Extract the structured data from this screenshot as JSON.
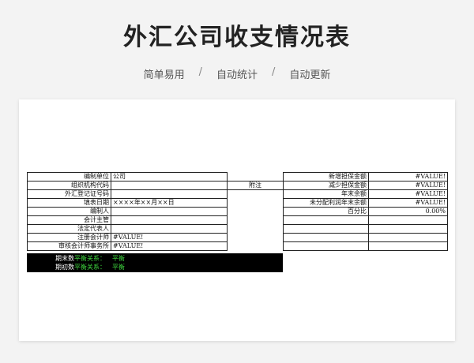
{
  "title": "外汇公司收支情况表",
  "subtitle": {
    "items": [
      "简单易用",
      "自动统计",
      "自动更新"
    ],
    "separator": "/"
  },
  "form": {
    "left_rows": [
      {
        "label": "编制单位",
        "value": "公司",
        "note": ""
      },
      {
        "label": "组织机构代码",
        "value": "",
        "note": "附注"
      },
      {
        "label": "外汇登记证号码",
        "value": "",
        "note": ""
      },
      {
        "label": "填表日期",
        "value": "××××年××月××日",
        "note": ""
      },
      {
        "label": "编制人",
        "value": "",
        "note": ""
      },
      {
        "label": "会计主管",
        "value": "",
        "note": ""
      },
      {
        "label": "法定代表人",
        "value": "",
        "note": ""
      },
      {
        "label": "注册会计师",
        "value": "#VALUE!",
        "note": ""
      },
      {
        "label": "审核会计师事务所",
        "value": "#VALUE!",
        "note": ""
      }
    ],
    "right_rows": [
      {
        "label": "新增担保金额",
        "value": "#VALUE!"
      },
      {
        "label": "减少担保金额",
        "value": "#VALUE!"
      },
      {
        "label": "年末余额",
        "value": "#VALUE!"
      },
      {
        "label": "未分配利润年末余额",
        "value": "#VALUE!"
      },
      {
        "label": "百分比",
        "value": "0.00%"
      },
      {
        "label": "",
        "value": ""
      },
      {
        "label": "",
        "value": ""
      },
      {
        "label": "",
        "value": ""
      },
      {
        "label": "",
        "value": ""
      }
    ],
    "balance": [
      {
        "label": "期末数",
        "relation": "平衡关系：",
        "status": "平衡"
      },
      {
        "label": "期初数",
        "relation": "平衡关系：",
        "status": "平衡"
      }
    ]
  }
}
